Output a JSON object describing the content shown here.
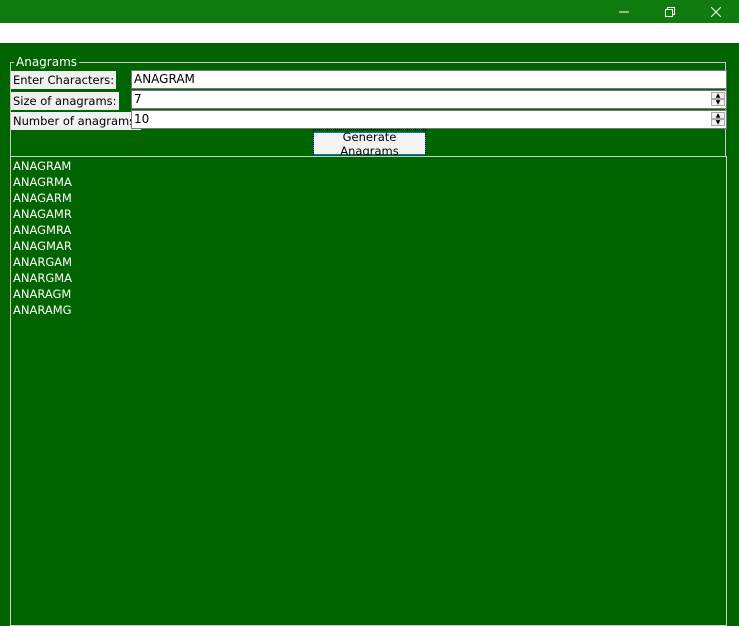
{
  "window": {
    "minimize_glyph": "—",
    "maximize_glyph": "❐",
    "close_glyph": "✕"
  },
  "group": {
    "title": "Anagrams"
  },
  "form": {
    "chars_label": "Enter Characters:",
    "chars_value": "ANAGRAM",
    "size_label": "Size of anagrams:",
    "size_value": "7",
    "num_label": "Number of anagrams:",
    "num_value": "10",
    "generate_label": "Generate Anagrams"
  },
  "results": [
    "ANAGRAM",
    "ANAGRMA",
    "ANAGARM",
    "ANAGAMR",
    "ANAGMRA",
    "ANAGMAR",
    "ANARGAM",
    "ANARGMA",
    "ANARAGM",
    "ANARAMG"
  ],
  "colors": {
    "titlebar": "#107c10",
    "background": "#006400",
    "text": "#ffffff"
  }
}
